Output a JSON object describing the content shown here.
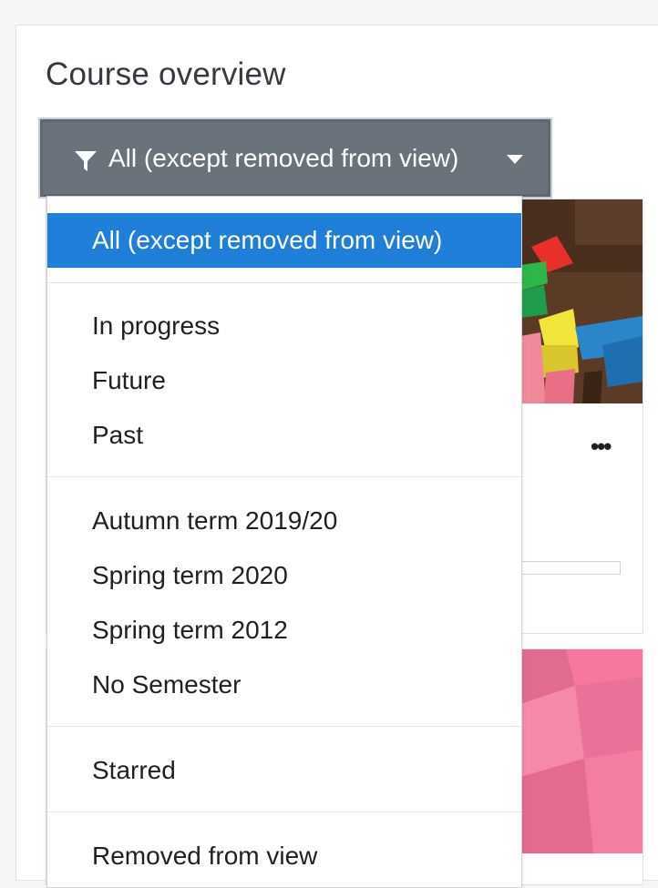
{
  "block": {
    "title": "Course overview"
  },
  "filter": {
    "selected_label": "All (except removed from view)",
    "icon": "filter-funnel-icon",
    "caret_icon": "caret-down-icon"
  },
  "dropdown": {
    "items": [
      {
        "label": "All (except removed from view)",
        "active": true
      },
      {
        "label": "In progress",
        "active": false
      },
      {
        "label": "Future",
        "active": false
      },
      {
        "label": "Past",
        "active": false
      },
      {
        "label": "Autumn term 2019/20",
        "active": false
      },
      {
        "label": "Spring term 2020",
        "active": false
      },
      {
        "label": "Spring term 2012",
        "active": false
      },
      {
        "label": "No Semester",
        "active": false
      },
      {
        "label": "Starred",
        "active": false
      },
      {
        "label": "Removed from view",
        "active": false
      }
    ]
  },
  "course_cards": {
    "more_label": "•••"
  },
  "colors": {
    "active_item_bg": "#1f7fd8",
    "filter_button_bg": "#6a737b"
  }
}
